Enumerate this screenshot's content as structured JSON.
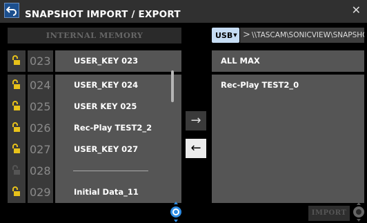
{
  "window": {
    "title": "SNAPSHOT IMPORT / EXPORT"
  },
  "left_panel": {
    "header": "INTERNAL MEMORY",
    "rows": [
      {
        "num": "023",
        "name": "USER_KEY 023",
        "locked": true
      },
      {
        "num": "024",
        "name": "USER_KEY 024",
        "locked": true
      },
      {
        "num": "025",
        "name": "USER KEY 025",
        "locked": true
      },
      {
        "num": "026",
        "name": "Rec-Play TEST2_2",
        "locked": true
      },
      {
        "num": "027",
        "name": "USER_KEY 027",
        "locked": true
      },
      {
        "num": "028",
        "name": "",
        "locked": false
      },
      {
        "num": "029",
        "name": "Initial Data_11",
        "locked": true
      }
    ]
  },
  "transfer": {
    "export_arrow": "→",
    "import_arrow": "←"
  },
  "right_panel": {
    "source_label": "USB",
    "path": "\\\\TASCAM\\SONICVIEW\\SNAPSHOT\\",
    "rows": [
      "ALL MAX",
      "Rec-Play TEST2_0",
      "",
      "",
      "",
      "",
      ""
    ]
  },
  "footer": {
    "import_label": "IMPORT"
  },
  "colors": {
    "lock_active": "#e8c21a",
    "lock_inactive": "#555555",
    "encoder_blue": "#2f8de4",
    "titlebar": "#303030"
  }
}
